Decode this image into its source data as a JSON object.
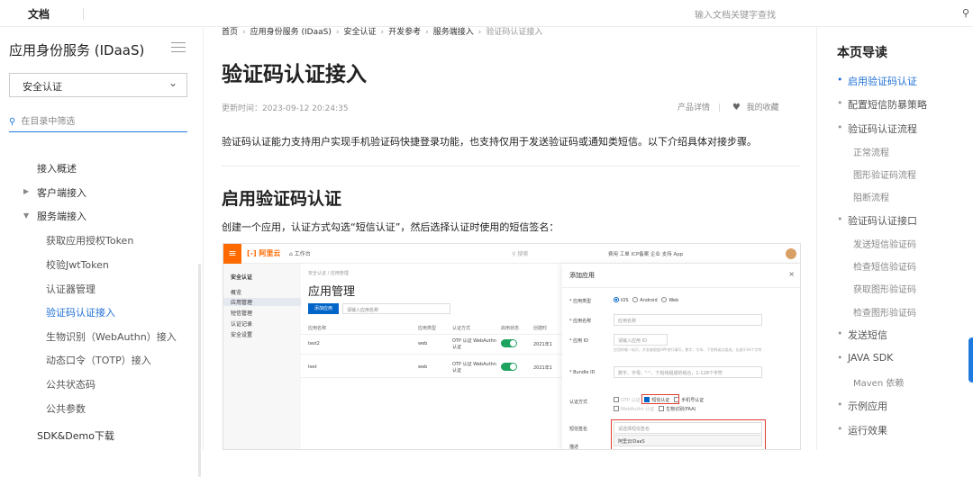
{
  "topbar": {
    "brand": "文档",
    "search_placeholder": "输入文档关键字查找"
  },
  "sidebar": {
    "title": "应用身份服务 (IDaaS)",
    "select_value": "安全认证",
    "filter_placeholder": "在目录中筛选",
    "items": [
      {
        "label": "接入概述"
      },
      {
        "label": "客户端接入"
      },
      {
        "label": "服务端接入"
      },
      {
        "label": "获取应用授权Token"
      },
      {
        "label": "校验JwtToken"
      },
      {
        "label": "认证器管理"
      },
      {
        "label": "验证码认证接入"
      },
      {
        "label": "生物识别（WebAuthn）接入"
      },
      {
        "label": "动态口令（TOTP）接入"
      },
      {
        "label": "公共状态码"
      },
      {
        "label": "公共参数"
      },
      {
        "label": "SDK&Demo下载"
      }
    ]
  },
  "breadcrumb": [
    "首页",
    "应用身份服务 (IDaaS)",
    "安全认证",
    "开发参考",
    "服务端接入",
    "验证码认证接入"
  ],
  "article": {
    "title": "验证码认证接入",
    "updated": "更新时间：2023-09-12 20:24:35",
    "product_detail": "产品详情",
    "divider": "|",
    "favorite": "我的收藏",
    "intro": "验证码认证能力支持用户实现手机验证码快捷登录功能，也支持仅用于发送验证码或通知类短信。以下介绍具体对接步骤。",
    "h2": "启用验证码认证",
    "p2": "创建一个应用，认证方式勾选“短信认证”，然后选择认证时使用的短信签名："
  },
  "shot": {
    "logo": "阿里云",
    "workspace": "工作台",
    "search": "搜索",
    "nav": "费用  工单  ICP备案  企业  支持  App",
    "side_title": "安全认证",
    "side_items": [
      "概览",
      "应用管理",
      "短信管理",
      "认证记录",
      "安全设置"
    ],
    "crumb": "安全认证 / 应用管理",
    "heading": "应用管理",
    "add_btn": "添加应用",
    "search_ph": "请输入应用名称",
    "headers": [
      "应用名称",
      "应用类型",
      "认证方式",
      "启用状态",
      "创建时"
    ],
    "rows": [
      {
        "name": "test2",
        "type": "web",
        "auth": "OTP 认证 WebAuthn 认证",
        "date": "2021年1"
      },
      {
        "name": "test",
        "type": "web",
        "auth": "OTP 认证 WebAuthn 认证",
        "date": "2021年1"
      }
    ],
    "dialog": {
      "title": "添加应用",
      "close": "×",
      "type_label": "* 应用类型",
      "type_opts": [
        "iOS",
        "Android",
        "Web"
      ],
      "name_label": "* 应用名称",
      "name_ph": "应用名称",
      "id_label": "* 应用 ID",
      "id_ph": "请输入应用 ID",
      "id_hint": "应用的唯一标识，开发者根据APP进行填写，数字、字母、下划线或点组成，长度4-64个字符",
      "bundle_label": "* Bundle ID",
      "bundle_ph": "数字、字母、\"-\"、下划线组成的组合，1-128个字符",
      "auth_label": "认证方式",
      "auth_opts": [
        "OTP 认证",
        "短信认证",
        "手机号认证",
        "WebAuthn 认证",
        "生物识别(FAA)"
      ],
      "sign_label": "短信签名",
      "sign_ph": "请选择短信签名",
      "sign_opt": "阿里云IDaaS",
      "desc_label": "描述"
    }
  },
  "toc": {
    "title": "本页导读",
    "items": [
      {
        "label": "启用验证码认证"
      },
      {
        "label": "配置短信防暴策略"
      },
      {
        "label": "验证码认证流程"
      },
      {
        "label": "正常流程"
      },
      {
        "label": "图形验证码流程"
      },
      {
        "label": "阻断流程"
      },
      {
        "label": "验证码认证接口"
      },
      {
        "label": "发送短信验证码"
      },
      {
        "label": "检查短信验证码"
      },
      {
        "label": "获取图形验证码"
      },
      {
        "label": "检查图形验证码"
      },
      {
        "label": "发送短信"
      },
      {
        "label": "JAVA SDK"
      },
      {
        "label": "Maven 依赖"
      },
      {
        "label": "示例应用"
      },
      {
        "label": "运行效果"
      }
    ]
  }
}
